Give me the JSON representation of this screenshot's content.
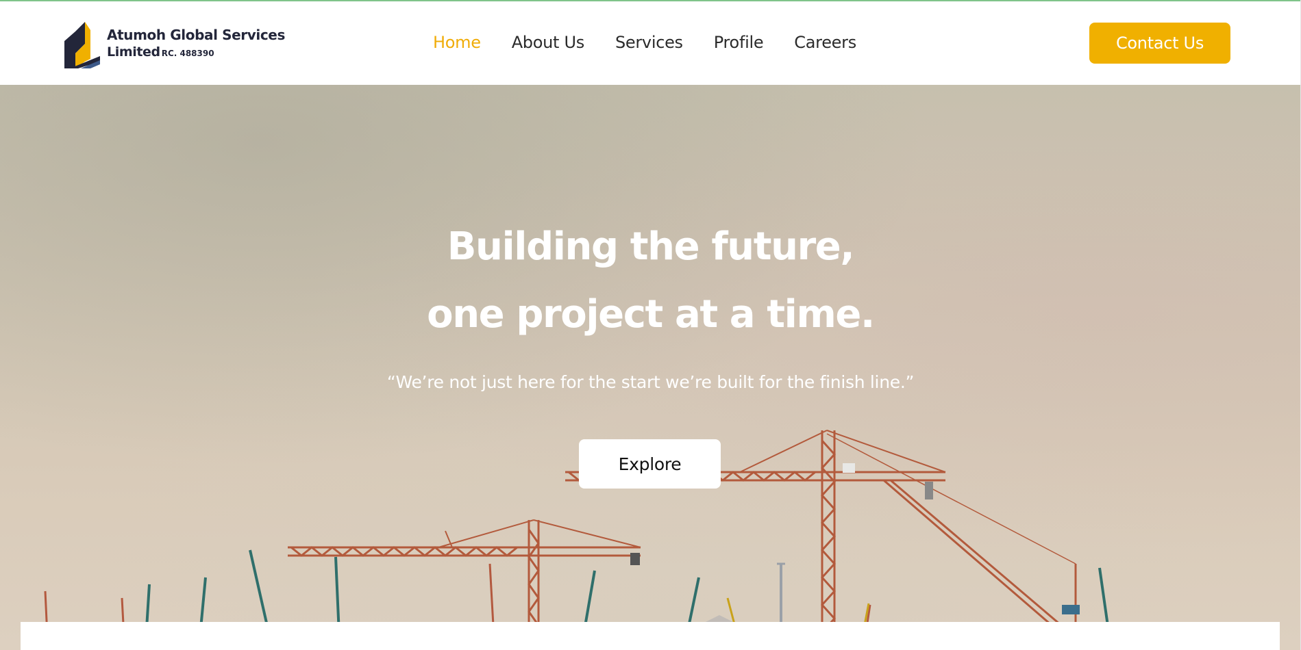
{
  "brand": {
    "name_line1": "Atumoh Global Services",
    "name_line2": "Limited",
    "rc_number": "RC. 488390",
    "logo_icon": "building-logo-icon",
    "colors": {
      "navy": "#23263a",
      "gold": "#f0b000"
    }
  },
  "nav": {
    "items": [
      {
        "label": "Home",
        "active": true
      },
      {
        "label": "About Us",
        "active": false
      },
      {
        "label": "Services",
        "active": false
      },
      {
        "label": "Profile",
        "active": false
      },
      {
        "label": "Careers",
        "active": false
      }
    ],
    "active_color": "#f0ac08"
  },
  "header": {
    "contact_label": "Contact Us"
  },
  "hero": {
    "heading_line1": "Building the future,",
    "heading_line2": "one project at a time.",
    "quote": "“We’re not just here for the start we’re built for the finish line.”",
    "explore_label": "Explore",
    "background": "construction-cranes-photo"
  }
}
